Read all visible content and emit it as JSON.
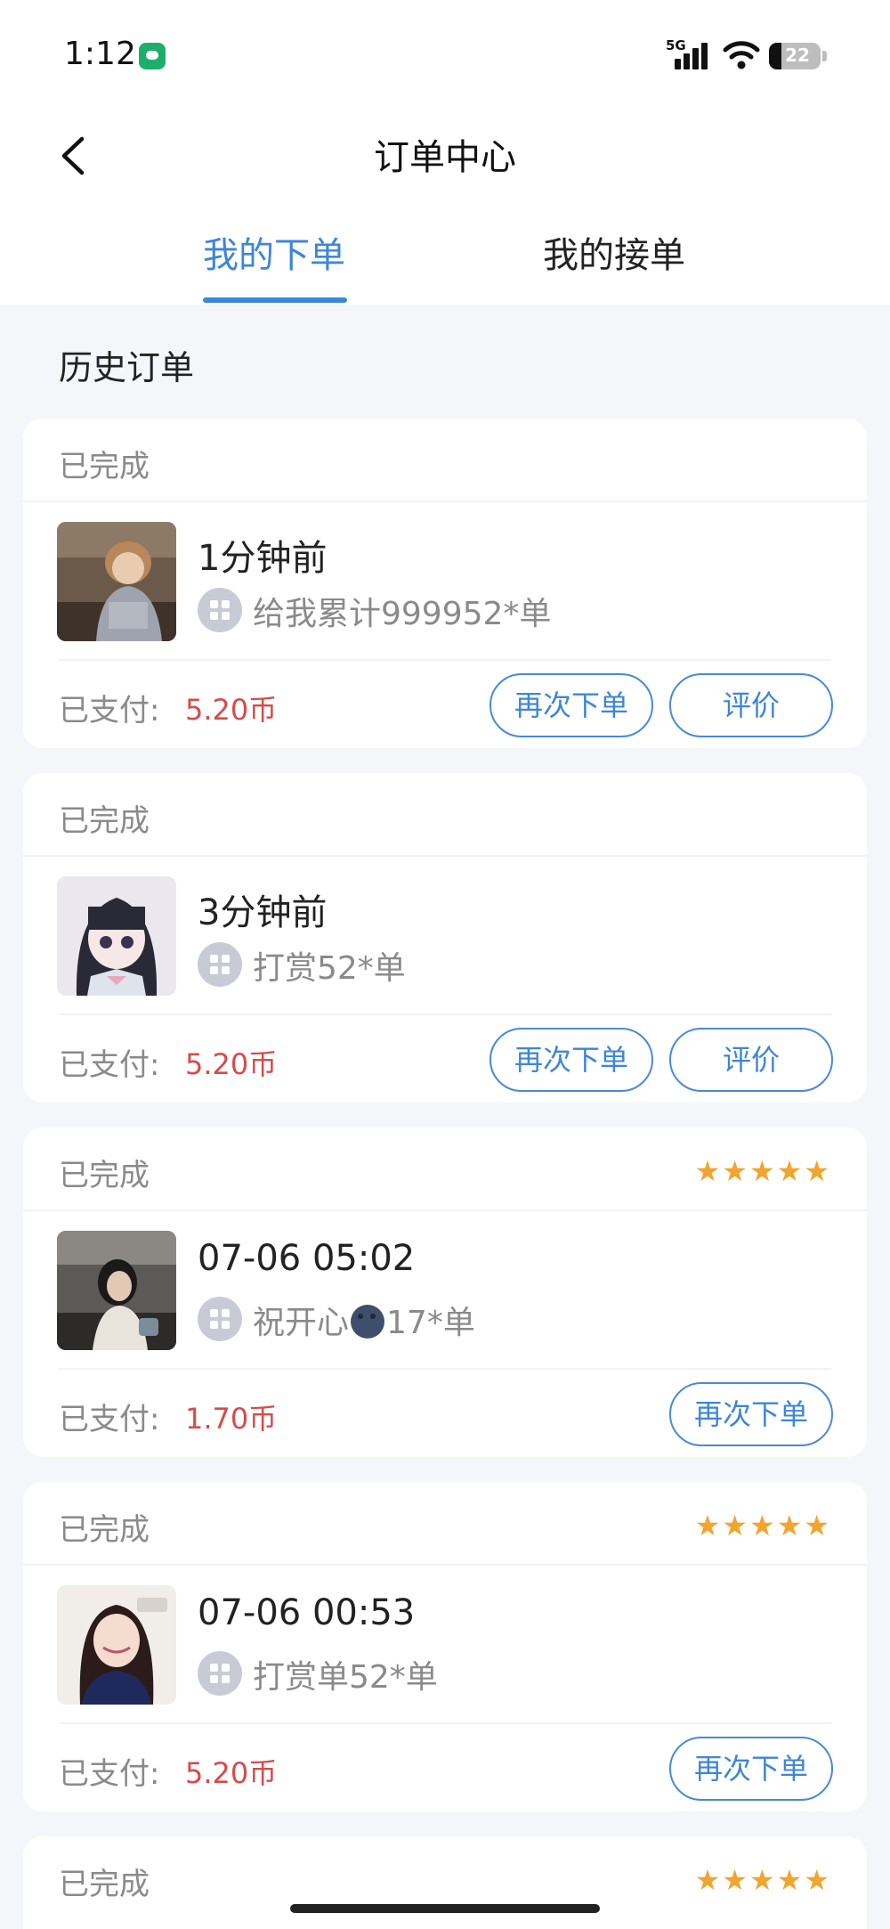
{
  "status_bar": {
    "time": "1:12",
    "network": "5G",
    "battery": "22"
  },
  "header": {
    "title": "订单中心",
    "back_icon": "chevron-left-icon"
  },
  "tabs": [
    {
      "label": "我的下单",
      "active": true
    },
    {
      "label": "我的接单",
      "active": false
    }
  ],
  "section_title": "历史订单",
  "colors": {
    "accent": "#3d86d6",
    "price": "#d64b4b",
    "star": "#f2a52e",
    "background": "#f4f6fa"
  },
  "orders": [
    {
      "status": "已完成",
      "time": "1分钟前",
      "desc_before": "给我累计999952*单",
      "desc_after": "",
      "paid_label": "已支付:",
      "amount": "5.20币",
      "stars": "",
      "rating": 0,
      "buttons": [
        "再次下单",
        "评价"
      ]
    },
    {
      "status": "已完成",
      "time": "3分钟前",
      "desc_before": "打赏52*单",
      "desc_after": "",
      "paid_label": "已支付:",
      "amount": "5.20币",
      "stars": "",
      "rating": 0,
      "buttons": [
        "再次下单",
        "评价"
      ]
    },
    {
      "status": "已完成",
      "time": "07-06 05:02",
      "desc_before": "祝开心",
      "desc_after": "17*单",
      "emoji": "moon-face-emoji",
      "paid_label": "已支付:",
      "amount": "1.70币",
      "stars": "★★★★★",
      "rating": 5,
      "buttons": [
        "再次下单"
      ]
    },
    {
      "status": "已完成",
      "time": "07-06 00:53",
      "desc_before": "打赏单52*单",
      "desc_after": "",
      "paid_label": "已支付:",
      "amount": "5.20币",
      "stars": "★★★★★",
      "rating": 5,
      "buttons": [
        "再次下单"
      ]
    },
    {
      "status": "已完成",
      "stars": "★★★★★",
      "rating": 5
    }
  ]
}
